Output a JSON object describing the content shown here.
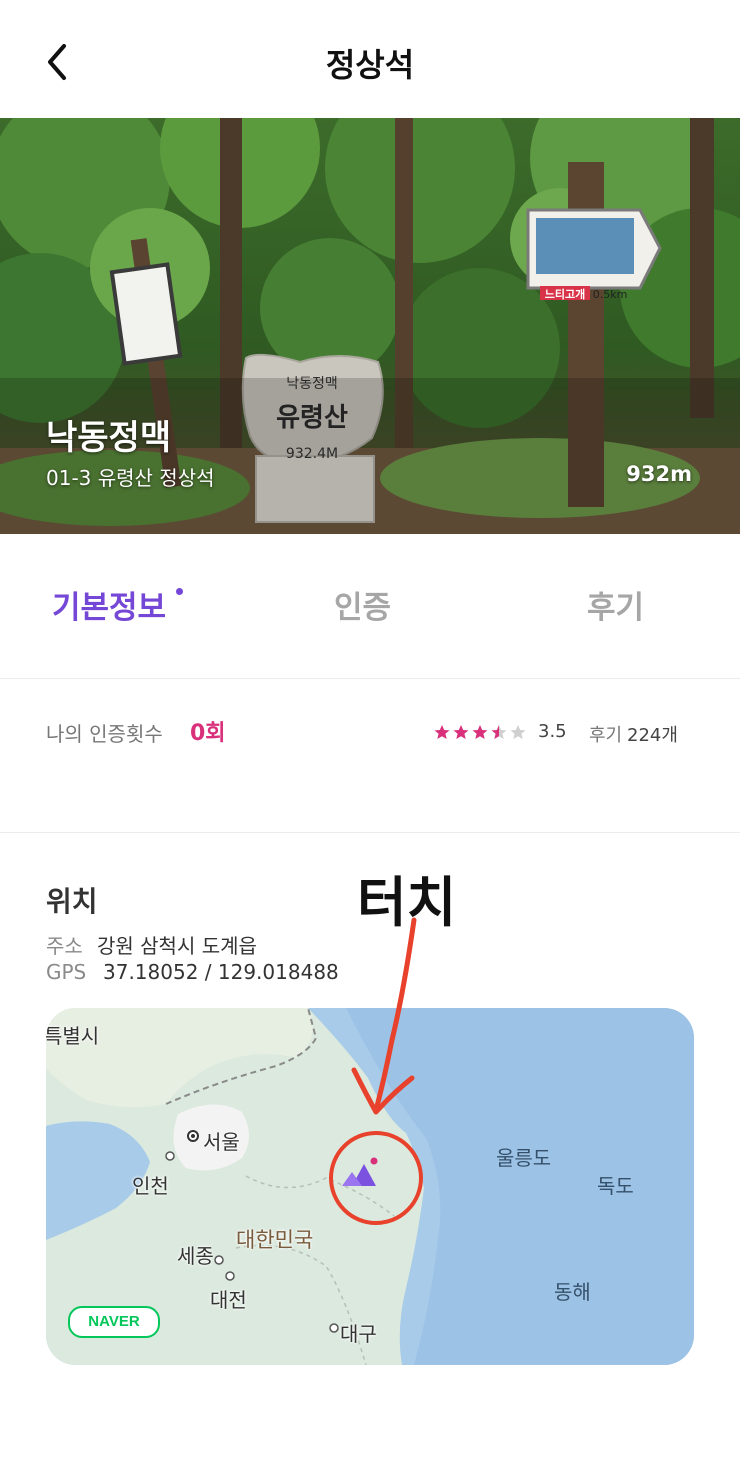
{
  "header": {
    "title": "정상석"
  },
  "hero": {
    "range": "낙동정맥",
    "subtitle": "01-3 유령산 정상석",
    "elevation": "932m",
    "sign_top": "낙동정맥",
    "sign_main": "유령산",
    "sign_elev": "932.4M",
    "direction_sign": "느티고개",
    "direction_dist": "0.5km"
  },
  "tabs": [
    {
      "label": "기본정보"
    },
    {
      "label": "인증"
    },
    {
      "label": "후기"
    }
  ],
  "stats": {
    "cert_label": "나의 인증횟수",
    "cert_count": "0회",
    "rating": "3.5",
    "review_label": "후기",
    "review_count": "224개"
  },
  "location": {
    "title": "위치",
    "address_label": "주소",
    "address": "강원 삼척시 도계읍",
    "gps_label": "GPS",
    "gps": "37.18052 / 129.018488"
  },
  "map": {
    "labels": {
      "special_city": "특별시",
      "seoul": "서울",
      "incheon": "인천",
      "country": "대한민국",
      "sejong": "세종",
      "daejeon": "대전",
      "daegu": "대구",
      "ulleungdo": "울릉도",
      "dokdo": "독도",
      "east_sea": "동해"
    },
    "provider": "NAVER"
  },
  "annotation": {
    "text": "터치"
  },
  "colors": {
    "accent": "#7547d6",
    "pink": "#d9307c",
    "annotation_red": "#e8412c",
    "sea": "#a8cbe9",
    "land": "#dbe9de"
  }
}
